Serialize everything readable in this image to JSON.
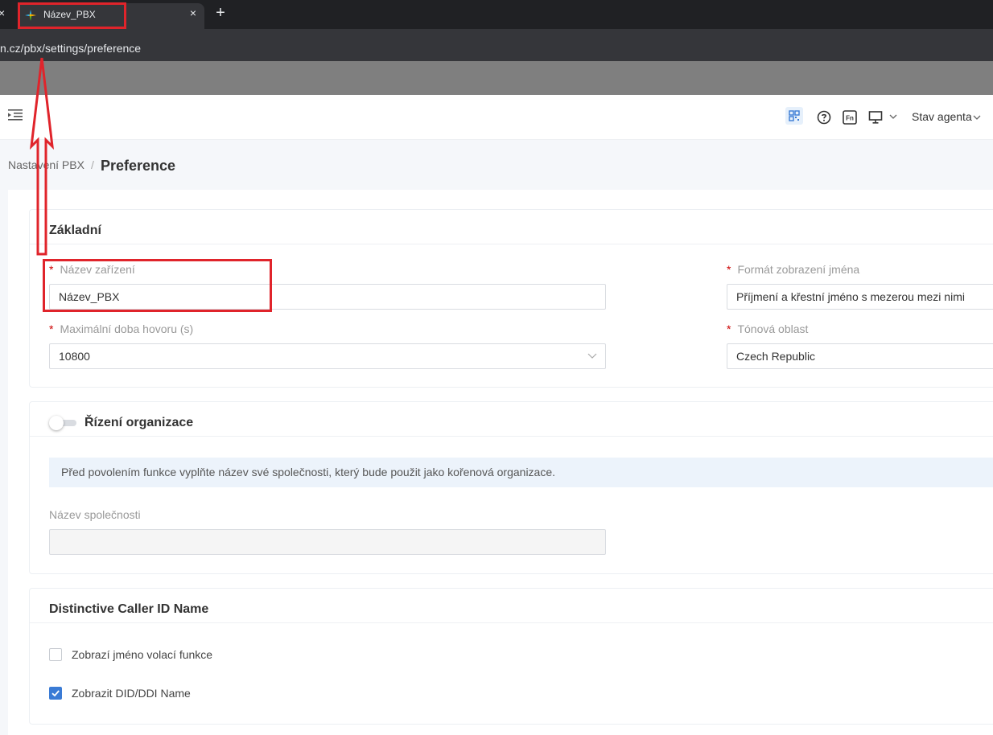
{
  "browser": {
    "tab_title": "Název_PBX",
    "close_glyph": "×",
    "new_tab_glyph": "+",
    "url": "n.cz/pbx/settings/preference"
  },
  "header": {
    "agent_status": "Stav agenta",
    "icons": [
      "menu-collapse-icon",
      "qr-code-icon",
      "help-icon",
      "fn-icon",
      "monitor-icon",
      "chevron-down-icon"
    ]
  },
  "breadcrumb": {
    "parent": "Nastavení PBX",
    "separator": "/",
    "current": "Preference"
  },
  "basic": {
    "title": "Základní",
    "device_name_label": "Název zařízení",
    "device_name_value": "Název_PBX",
    "name_format_label": "Formát zobrazení jména",
    "name_format_value": "Příjmení a křestní jméno s mezerou mezi nimi",
    "max_call_label": "Maximální doba hovoru (s)",
    "max_call_value": "10800",
    "tone_region_label": "Tónová oblast",
    "tone_region_value": "Czech Republic",
    "required_mark": "*"
  },
  "org": {
    "title": "Řízení organizace",
    "enabled": false,
    "info": "Před povolením funkce vyplňte název své společnosti, který bude použit jako kořenová organizace.",
    "company_label": "Název společnosti",
    "company_value": ""
  },
  "caller_id": {
    "title": "Distinctive Caller ID Name",
    "options": [
      {
        "label": "Zobrazí jméno volací funkce",
        "checked": false
      },
      {
        "label": "Zobrazit DID/DDI Name",
        "checked": true
      }
    ]
  },
  "colors": {
    "accent": "#3a7bd5",
    "required": "#cc0000",
    "annotation": "#e0242b"
  }
}
